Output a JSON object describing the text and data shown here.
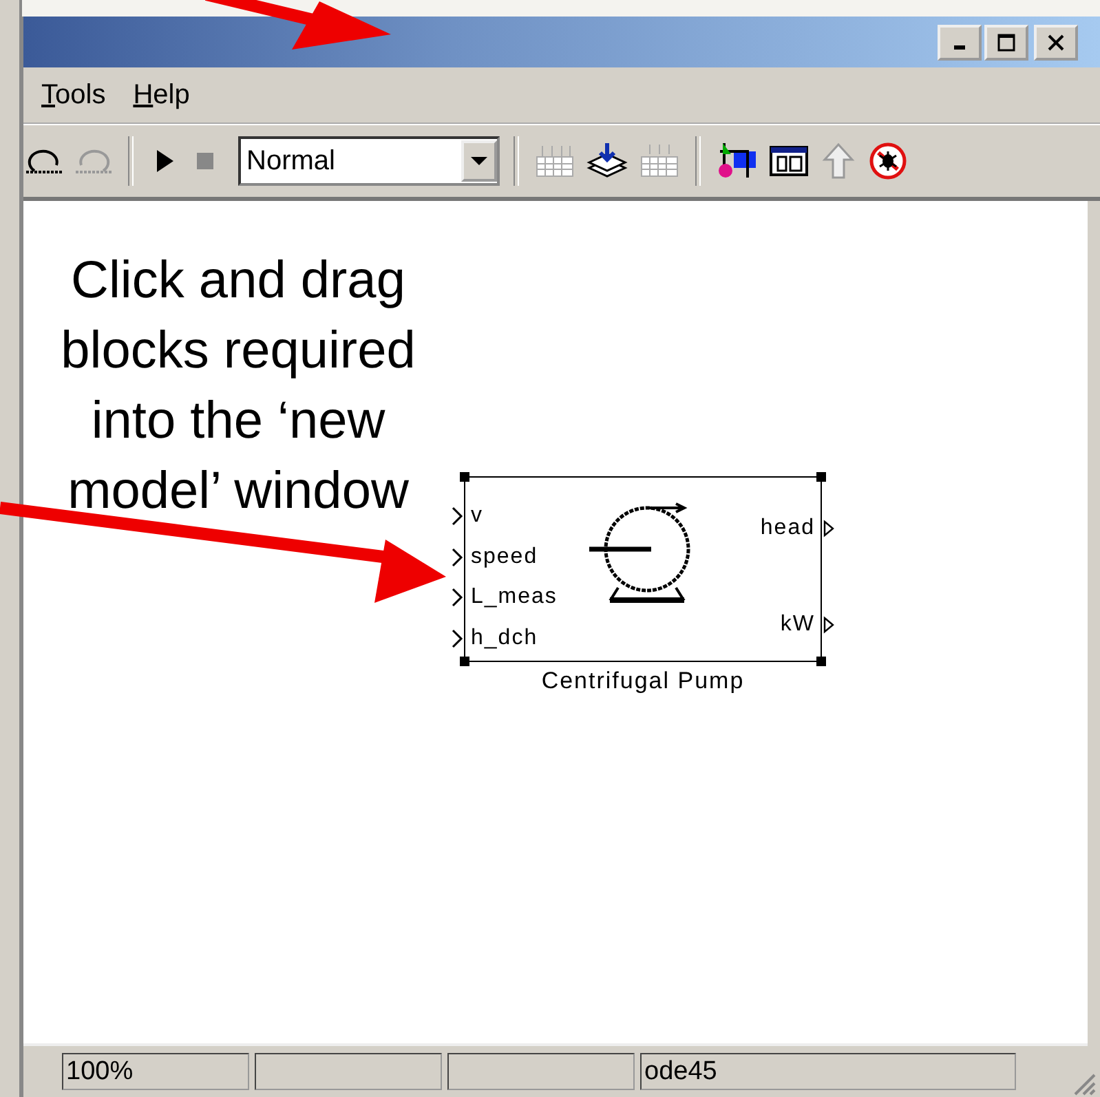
{
  "menu": [
    {
      "label": "Tools"
    },
    {
      "label": "Help"
    }
  ],
  "toolbar": {
    "mode": "Normal"
  },
  "annotation": {
    "text": "Click and drag blocks required into the ‘new model’ window"
  },
  "block": {
    "name": "Centrifugal Pump",
    "selected": true,
    "inputs": [
      "v",
      "speed",
      "L_meas",
      "h_dch"
    ],
    "outputs": [
      "head",
      "kW"
    ]
  },
  "status_bar": {
    "zoom": "100%",
    "solver": "ode45"
  }
}
